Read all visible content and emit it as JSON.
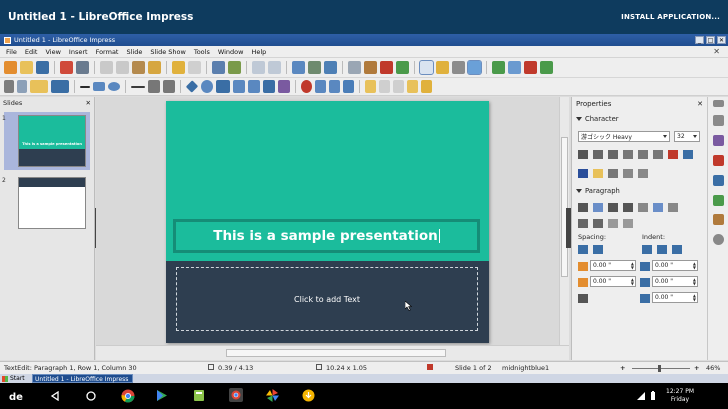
{
  "chrome": {
    "title": "Untitled 1 - LibreOffice Impress",
    "install_label": "INSTALL APPLICATION..."
  },
  "window": {
    "title": "Untitled 1 - LibreOffice Impress",
    "minimize": "_",
    "maximize": "□",
    "close": "✕"
  },
  "menu": {
    "items": [
      "File",
      "Edit",
      "View",
      "Insert",
      "Format",
      "Slide",
      "Slide Show",
      "Tools",
      "Window",
      "Help"
    ],
    "close": "✕"
  },
  "slides_panel": {
    "title": "Slides",
    "close": "✕",
    "thumbs": [
      {
        "number": "1",
        "text": "This is a sample presentation"
      },
      {
        "number": "2"
      }
    ]
  },
  "slide": {
    "title": "This is a sample presentation",
    "content_placeholder": "Click to add Text"
  },
  "properties": {
    "title": "Properties",
    "close": "✕",
    "character_label": "Character",
    "font_name": "游ゴシック Heavy",
    "font_size": "32",
    "paragraph_label": "Paragraph",
    "spacing_label": "Spacing:",
    "indent_label": "Indent:",
    "spin_values": [
      "0.00 \"",
      "0.00 \"",
      "0.00 \"",
      "0.00 \"",
      "0.00 \"",
      "0.00 \""
    ]
  },
  "status": {
    "textedit": "TextEdit: Paragraph 1, Row 1, Column 30",
    "position": "0.39 / 4.13",
    "size": "10.24 x 1.05",
    "slide_info": "Slide 1 of 2",
    "master": "midnightblue1",
    "zoom": "46%"
  },
  "taskbar": {
    "start": "Start",
    "task": "Untitled 1 - LibreOffice Impress"
  },
  "android": {
    "time": "12:27 PM",
    "day": "Friday"
  },
  "colors": {
    "accent_teal": "#1bbc9c",
    "dark_navy": "#2e3e50",
    "chrome_blue": "#0e3b5e"
  }
}
